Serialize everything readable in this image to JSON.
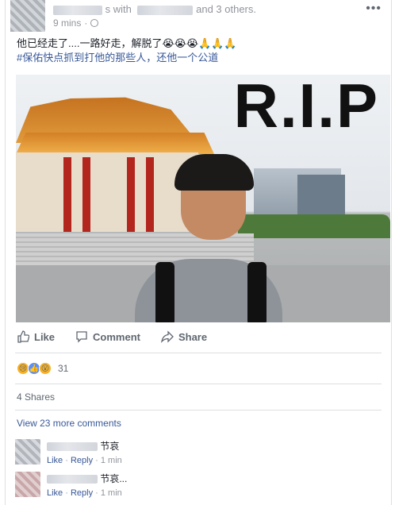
{
  "post": {
    "with_text": "s with",
    "others_text": "and 3 others.",
    "time": "9 mins",
    "more_label": "•••",
    "text_line1": "他已经走了....一路好走，解脱了😭😭😭🙏🙏🙏",
    "text_line2": "#保佑快点抓到打他的那些人，还他一个公道",
    "image_caption": "R.I.P"
  },
  "actions": {
    "like": "Like",
    "comment": "Comment",
    "share": "Share"
  },
  "reactions": {
    "count": "31"
  },
  "shares_text": "4 Shares",
  "view_more": "View 23 more comments",
  "comments": [
    {
      "text": "节哀",
      "like": "Like",
      "reply": "Reply",
      "time": "1 min"
    },
    {
      "text": "节哀...",
      "like": "Like",
      "reply": "Reply",
      "time": "1 min"
    }
  ],
  "colors": {
    "link": "#385898",
    "muted": "#90949c",
    "divider": "#dddfe2"
  }
}
